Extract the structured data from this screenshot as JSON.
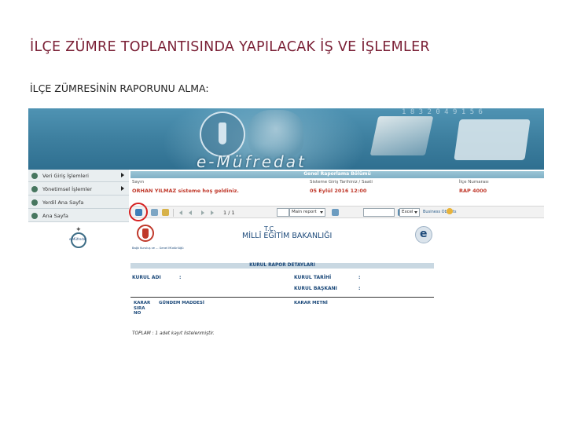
{
  "slide": {
    "title": "İLÇE ZÜMRE TOPLANTISINDA YAPILACAK İŞ VE İŞLEMLER",
    "subtitle": "İLÇE ZÜMRESİNİN RAPORUNU ALMA:"
  },
  "screenshot": {
    "banner": {
      "brand": "e-Müfredat",
      "numbers": "1 8 3 2 0 4 9 1 5 6"
    },
    "sidebar": {
      "items": [
        {
          "label": "Veri Giriş İşlemleri",
          "has_arrow": true
        },
        {
          "label": "Yönetimsel İşlemler",
          "has_arrow": true
        },
        {
          "label": "Yerdil Ana Sayfa",
          "has_arrow": false
        },
        {
          "label": "Ana Sayfa",
          "has_arrow": false
        }
      ],
      "badge_label": "e-Müfredat"
    },
    "header": {
      "title": "Genel Raporlama Bölümü",
      "col1_label": "Sayın",
      "col1_value": "ORHAN YILMAZ sisteme hoş geldiniz.",
      "col2_label": "Sisteme Giriş Tarihiniz / Saati",
      "col2_value": "05 Eylül 2016 12:00",
      "col3_label": "İlçe Numarası",
      "col3_value": "RAP 4000"
    },
    "toolbar": {
      "page_indicator": "1 / 1",
      "zoom_value": "Main report",
      "export_value": "Excel",
      "brand": "Business Objects"
    },
    "report": {
      "tc": "T.C.",
      "ministry": "MİLLÎ EĞİTİM BAKANLIĞI",
      "left_logo_text": "Bağlı Kuruluş ve ... Genel Müdürlüğü",
      "section_title": "KURUL RAPOR DETAYLARI",
      "kurul_adi_label": "KURUL ADI",
      "kurul_tarihi_label": "KURUL TARİHİ",
      "kurul_baskani_label": "KURUL BAŞKANI",
      "colon": ":",
      "col_sira": "KARAR SIRA NO",
      "col_gundem": "GÜNDEM MADDESİ",
      "col_metin": "KARAR METNİ",
      "total": "TOPLAM : 1 adet kayıt listelenmiştir."
    }
  }
}
